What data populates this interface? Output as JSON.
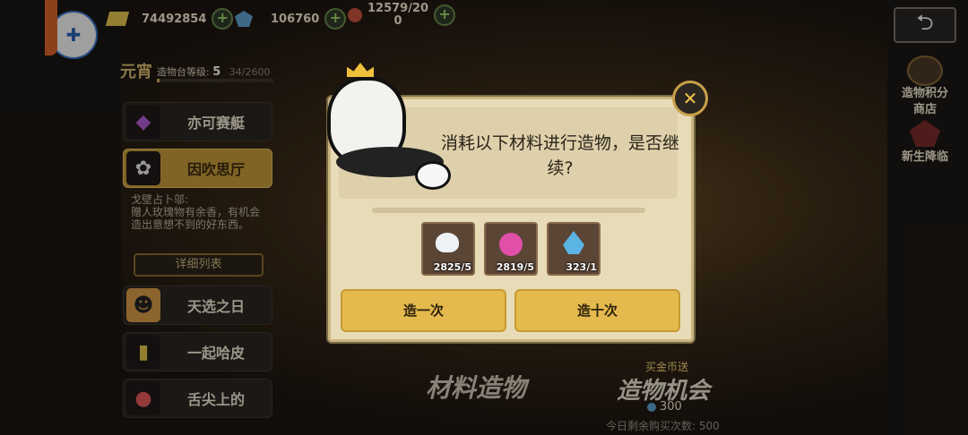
{
  "resources": {
    "gold": "74492854",
    "gems": "106760",
    "stamina": "12579/20",
    "stamina_overflow": "0"
  },
  "workshop": {
    "badge": "元宵",
    "level_label": "造物台等级:",
    "level": "5",
    "level_progress": "34/2600"
  },
  "sidebar": {
    "items": [
      {
        "label": "亦可赛艇",
        "icon": "gem-icon"
      },
      {
        "label": "因吹思厅",
        "icon": "flower-icon"
      },
      {
        "label": "天选之日",
        "icon": "portrait-icon"
      },
      {
        "label": "一起哈皮",
        "icon": "card-icon"
      },
      {
        "label": "舌尖上的",
        "icon": "lips-icon"
      }
    ],
    "description_title": "戈壁占卜邬:",
    "description": "赠人玫瑰物有余香，有机会造出意想不到的好东西。",
    "detail_button": "详细列表"
  },
  "right_menu": {
    "shop_label": "造物积分商店",
    "event_label": "新生降临"
  },
  "bottom": {
    "material_craft": "材料造物",
    "buy_tag": "买金币送",
    "craft_chance": "造物机会",
    "price": "300",
    "remaining": "今日剩余购买次数: 500"
  },
  "dialog": {
    "message": "消耗以下材料进行造物，是否继续?",
    "materials": [
      {
        "name": "skull-material-icon",
        "count": "2825/5"
      },
      {
        "name": "apple-material-icon",
        "count": "2819/5"
      },
      {
        "name": "crystal-material-icon",
        "count": "323/1"
      }
    ],
    "craft_once": "造一次",
    "craft_ten": "造十次"
  },
  "colors": {
    "accent": "#e4b94d",
    "dialog_bg": "#e8dcb8",
    "selected_tab": "#c59a3a"
  }
}
